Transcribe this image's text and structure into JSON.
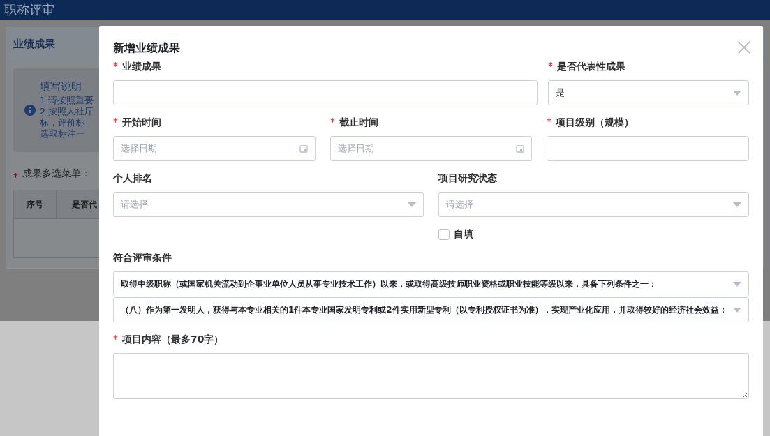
{
  "app_title": "职称评审",
  "background": {
    "panel_title": "业绩成果",
    "notice_title": "填写说明",
    "notice_lines": [
      "1.请按照重要",
      "2.按照人社厅",
      "标，评价标",
      "选取标注一"
    ],
    "multi_select_label": "成果多选菜单：",
    "multi_select_required": true,
    "table_columns": [
      "序号",
      "是否代"
    ]
  },
  "dialog": {
    "title": "新增业绩成果",
    "rows": [
      {
        "fields": [
          {
            "kind": "text",
            "label": "业绩成果",
            "required": true
          },
          {
            "kind": "select",
            "label": "是否代表性成果",
            "required": true,
            "value": "是"
          }
        ]
      },
      {
        "fields": [
          {
            "kind": "date",
            "label": "开始时间",
            "required": true,
            "placeholder": "选择日期"
          },
          {
            "kind": "date",
            "label": "截止时间",
            "required": true,
            "placeholder": "选择日期"
          },
          {
            "kind": "text",
            "label": "项目级别（规模）",
            "required": true
          }
        ]
      },
      {
        "fields": [
          {
            "kind": "select",
            "label": "个人排名",
            "required": false,
            "placeholder": "请选择"
          },
          {
            "kind": "select",
            "label": "项目研究状态",
            "required": false,
            "placeholder": "请选择",
            "checkbox": {
              "label": "自填",
              "checked": false
            }
          }
        ]
      },
      {
        "fields": [
          {
            "kind": "select_stack",
            "label": "符合评审条件",
            "required": false,
            "values": [
              "取得中级职称（或国家机关流动到企事业单位人员从事专业技术工作）以来，或取得高级技师职业资格或职业技能等级以来，具备下列条件之一：",
              "（八）作为第一发明人，获得与本专业相关的1件本专业国家发明专利或2件实用新型专利（以专利授权证书为准），实现产业化应用，并取得较好的经济社会效益；"
            ]
          }
        ]
      },
      {
        "fields": [
          {
            "kind": "textarea",
            "label": "项目内容（最多70字）",
            "required": true
          }
        ]
      }
    ]
  }
}
